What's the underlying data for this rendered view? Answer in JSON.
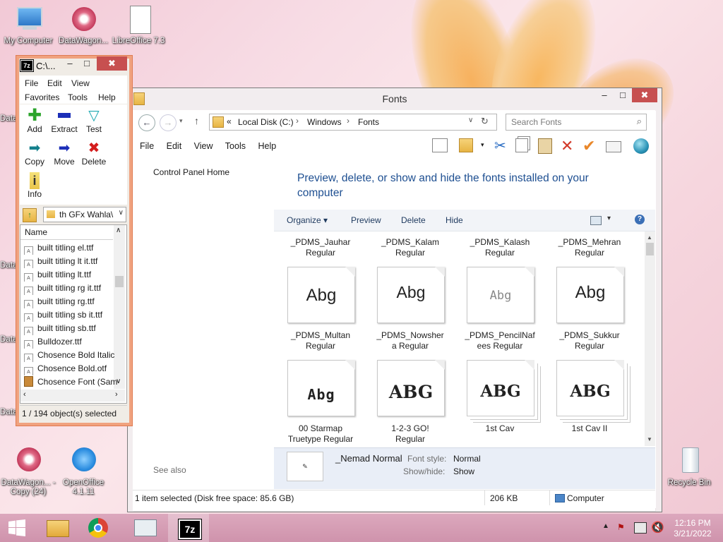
{
  "desktop": {
    "icons": [
      {
        "label": "My Computer"
      },
      {
        "label": "DataWagon..."
      },
      {
        "label": "LibreOffice 7.3"
      },
      {
        "label": "DataWagon... - Copy (24)"
      },
      {
        "label": "OpenOffice 4.1.11"
      },
      {
        "label": "Recycle Bin"
      }
    ],
    "left_clipped": [
      "Data",
      "Data",
      "Data",
      "Data"
    ]
  },
  "sevenzip": {
    "title": "C:\\...",
    "controls": {
      "minimize": "–",
      "maximize": "□",
      "close": "✖"
    },
    "menu": [
      "File",
      "Edit",
      "View",
      "Favorites",
      "Tools",
      "Help"
    ],
    "toolbar": [
      "Add",
      "Extract",
      "Test",
      "Copy",
      "Move",
      "Delete",
      "Info"
    ],
    "path": "th GFx Wahla\\",
    "column": "Name",
    "files": [
      "built titling el.ttf",
      "built titling lt it.ttf",
      "built titling lt.ttf",
      "built titling rg it.ttf",
      "built titling rg.ttf",
      "built titling sb it.ttf",
      "built titling sb.ttf",
      "Bulldozer.ttf",
      "Chosence Bold Italic",
      "Chosence Bold.otf",
      "Chosence Font (Sam"
    ],
    "status": "1 / 194 object(s) selected"
  },
  "explorer": {
    "title": "Fonts",
    "controls": {
      "minimize": "–",
      "maximize": "□",
      "close": "✖"
    },
    "breadcrumb": {
      "prefix": "«",
      "parts": [
        "Local Disk (C:)",
        "Windows",
        "Fonts"
      ]
    },
    "search_placeholder": "Search Fonts",
    "menu": [
      "File",
      "Edit",
      "View",
      "Tools",
      "Help"
    ],
    "left_nav": {
      "home": "Control Panel Home",
      "see_also": "See also"
    },
    "heading": "Preview, delete, or show and hide the fonts installed on your computer",
    "commandbar": [
      "Organize ▾",
      "Preview",
      "Delete",
      "Hide"
    ],
    "top_row": [
      {
        "name": "_PDMS_Jauhar",
        "style": "Regular"
      },
      {
        "name": "_PDMS_Kalam",
        "style": "Regular"
      },
      {
        "name": "_PDMS_Kalash",
        "style": "Regular"
      },
      {
        "name": "_PDMS_Mehran",
        "style": "Regular"
      }
    ],
    "fonts": [
      {
        "sample": "Abg",
        "name": "_PDMS_Multan",
        "style": "Regular"
      },
      {
        "sample": "Abg",
        "name": "_PDMS_Nowsher",
        "style": "a Regular"
      },
      {
        "sample": "Abg",
        "name": "_PDMS_PencilNaf",
        "style": "ees Regular"
      },
      {
        "sample": "Abg",
        "name": "_PDMS_Sukkur",
        "style": "Regular"
      },
      {
        "sample": "Abg",
        "name": "00 Starmap",
        "style": "Truetype Regular"
      },
      {
        "sample": "ABG",
        "name": "1-2-3 GO!",
        "style": "Regular"
      },
      {
        "sample": "ABG",
        "name": "1st Cav",
        "style": ""
      },
      {
        "sample": "ABG",
        "name": "1st Cav II",
        "style": ""
      }
    ],
    "details": {
      "name": "_Nemad Normal",
      "font_style_label": "Font style:",
      "font_style": "Normal",
      "show_hide_label": "Show/hide:",
      "show_hide": "Show"
    },
    "statusbar": {
      "left": "1 item selected (Disk free space: 85.6 GB)",
      "size": "206 KB",
      "location": "Computer"
    }
  },
  "taskbar": {
    "time": "12:16 PM",
    "date": "3/21/2022",
    "sevenzip_label": "7z"
  }
}
